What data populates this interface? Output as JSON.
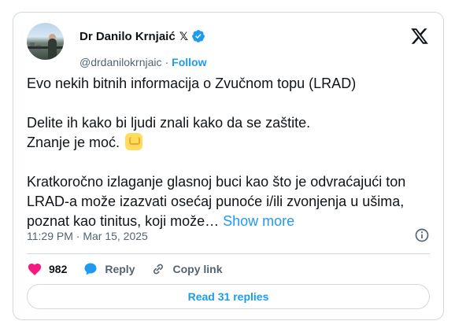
{
  "author": {
    "name": "Dr Danilo Krnjaić",
    "x_mark": "𝕏",
    "handle": "@drdanilokrnjaic",
    "separator": "·",
    "follow_label": "Follow",
    "verified_color": "#1d9bf0"
  },
  "tweet": {
    "line1": "Evo nekih bitnih informacija o Zvučnom topu (LRAD)",
    "line2": "Delite ih kako bi ljudi znali kako da se zaštite.",
    "line3": "Znanje je moć.",
    "emoji_icon": "raised-fist-emoji",
    "line4": "Kratkoročno izlaganje glasnoj buci kao što je odvraćajući ton LRAD-a može izazvati osećaj punoće i/ili zvonjenja u ušima, poznat kao tinitus, koji može…",
    "show_more": "Show more"
  },
  "meta": {
    "time": "11:29 PM · Mar 15, 2025",
    "info_icon": "info-icon"
  },
  "actions": {
    "like_count": "982",
    "reply_label": "Reply",
    "copy_link_label": "Copy link"
  },
  "read_replies_label": "Read 31 replies",
  "colors": {
    "accent": "#1d9bf0",
    "like": "#f91880",
    "secondary_text": "#536471",
    "border": "#cfd9de"
  }
}
